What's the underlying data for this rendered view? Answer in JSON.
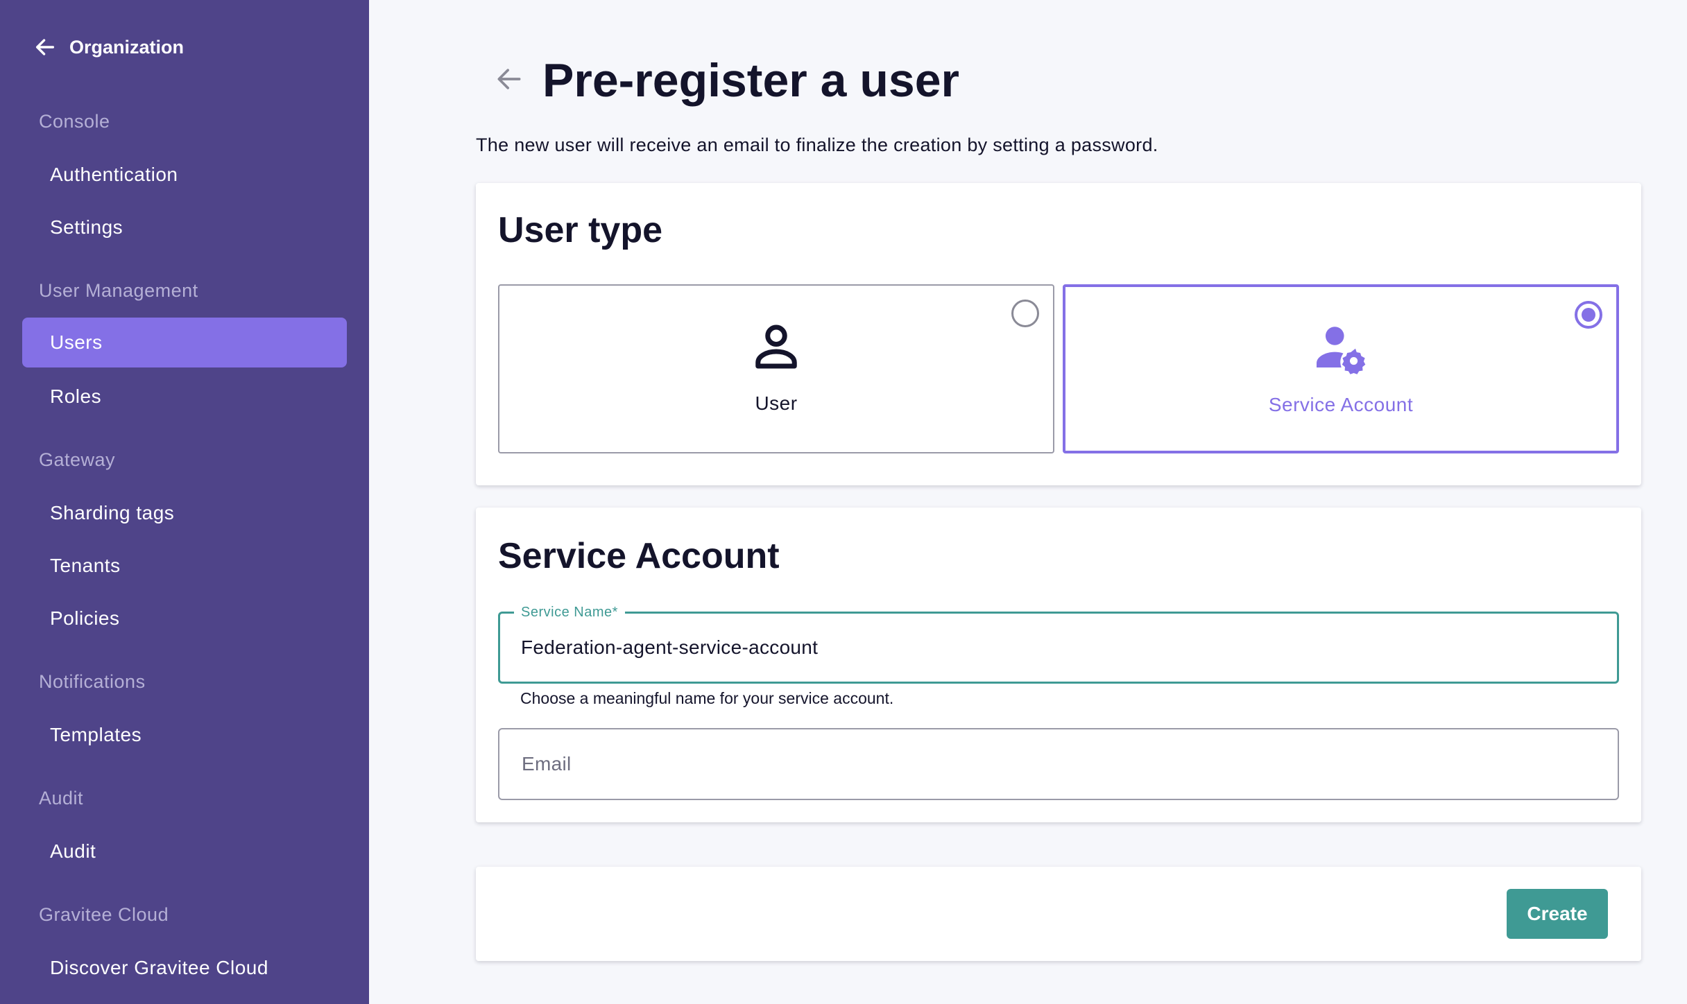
{
  "sidebar": {
    "back_label": "Organization",
    "sections": [
      {
        "title": "Console",
        "items": [
          "Authentication",
          "Settings"
        ]
      },
      {
        "title": "User Management",
        "items": [
          "Users",
          "Roles"
        ]
      },
      {
        "title": "Gateway",
        "items": [
          "Sharding tags",
          "Tenants",
          "Policies"
        ]
      },
      {
        "title": "Notifications",
        "items": [
          "Templates"
        ]
      },
      {
        "title": "Audit",
        "items": [
          "Audit"
        ]
      },
      {
        "title": "Gravitee Cloud",
        "items": [
          "Discover Gravitee Cloud"
        ]
      }
    ],
    "active_item": "Users"
  },
  "header": {
    "title": "Pre-register a user",
    "subtitle": "The new user will receive an email to finalize the creation by setting a password."
  },
  "user_type": {
    "title": "User type",
    "options": [
      {
        "label": "User",
        "icon": "person-outline-icon",
        "selected": false
      },
      {
        "label": "Service Account",
        "icon": "person-gear-icon",
        "selected": true
      }
    ]
  },
  "service_account": {
    "title": "Service Account",
    "service_name_label": "Service Name*",
    "service_name_value": "Federation-agent-service-account",
    "service_name_hint": "Choose a meaningful name for your service account.",
    "email_placeholder": "Email"
  },
  "actions": {
    "create_label": "Create"
  },
  "colors": {
    "sidebar_bg": "#4f4489",
    "accent_purple": "#8470e6",
    "accent_teal": "#3f9a94"
  }
}
